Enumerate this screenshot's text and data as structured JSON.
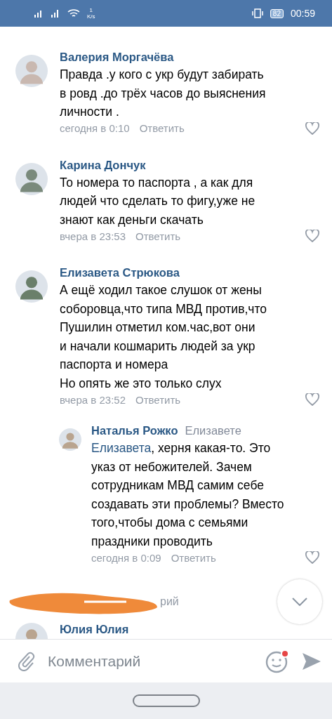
{
  "status_bar": {
    "speed": "1",
    "speed_unit": "K/s",
    "battery": "82",
    "time": "00:59"
  },
  "comments": [
    {
      "author": "Валерия Моргачёва",
      "text": "Правда .у кого с укр будут забирать\nв ровд .до трёх часов до выяснения\nличности .",
      "time": "сегодня в 0:10",
      "reply": "Ответить",
      "liked": false
    },
    {
      "author": "Карина Дончук",
      "text": "То номера то паспорта , а как для\nлюдей что сделать то фигу,уже не\nзнают как деньги скачать",
      "time": "вчера в 23:53",
      "reply": "Ответить",
      "liked": false
    },
    {
      "author": "Елизавета Стрюкова",
      "text": "А ещё ходил такое слушок от жены\nсоборовца,что типа МВД против,что\nПушилин отметил ком.час,вот они\nи начали кошмарить людей за укр\nпаспорта и номера\nНо опять же это только слух",
      "time": "вчера в 23:52",
      "reply": "Ответить",
      "liked": false,
      "replies": [
        {
          "author": "Наталья Рожко",
          "to": "Елизавете",
          "mention": "Елизавета",
          "text": ", херня какая-то. Это\nуказ от небожителей. Зачем\nсотрудникам МВД самим себе\nсоздавать эти проблемы? Вместо\nтого,чтобы дома с семьями\nпраздники проводить",
          "time": "сегодня в 0:09",
          "reply": "Ответить",
          "liked": false
        }
      ]
    }
  ],
  "hidden_row": {
    "visible_text": "рий"
  },
  "next_author": "Юлия Юлия",
  "composer": {
    "placeholder": "Комментарий",
    "emoji_badge": true
  }
}
